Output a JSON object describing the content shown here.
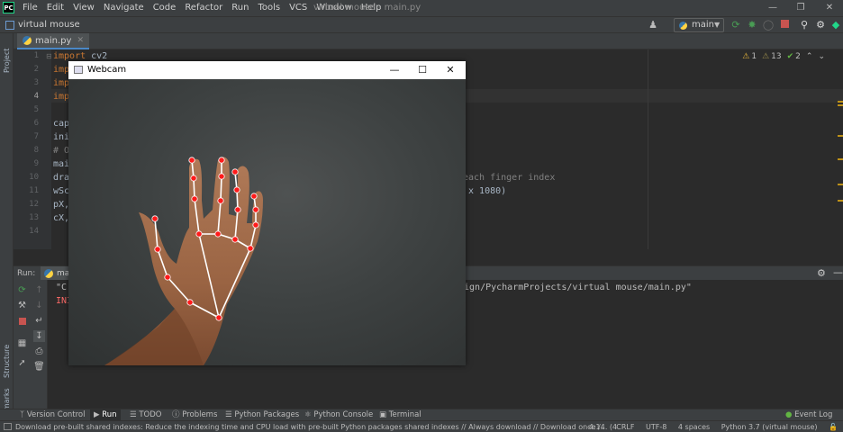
{
  "ide": {
    "logo": "PC",
    "menus": [
      "File",
      "Edit",
      "View",
      "Navigate",
      "Code",
      "Refactor",
      "Run",
      "Tools",
      "VCS",
      "Window",
      "Help"
    ],
    "window_title": "virtual mouse - main.py",
    "window_controls": [
      "minimize-icon",
      "restore-icon",
      "close-icon"
    ]
  },
  "navbar": {
    "project_name": "virtual mouse",
    "run_config": "main",
    "icons": [
      "user-icon",
      "run-icon",
      "debug-icon",
      "coverage-icon",
      "stop-icon",
      "search-icon",
      "gear-icon",
      "toolbox-icon"
    ]
  },
  "editor": {
    "tab_label": "main.py",
    "inspections": {
      "warnings": "1",
      "weak_warnings": "13",
      "typos": "2"
    },
    "line_numbers": [
      "1",
      "2",
      "3",
      "4",
      "5",
      "6",
      "7",
      "8",
      "9",
      "10",
      "11",
      "12",
      "13",
      "14"
    ],
    "lines": [
      {
        "kw": "import",
        "rest": " cv2"
      },
      {
        "kw": "imp",
        "rest": ""
      },
      {
        "kw": "imp",
        "rest": ""
      },
      {
        "kw": "imp",
        "rest": ""
      },
      {
        "kw": "",
        "rest": ""
      },
      {
        "kw": "",
        "rest": "cap"
      },
      {
        "kw": "",
        "rest": "ini"
      },
      {
        "kw": "",
        "rest": "# O"
      },
      {
        "kw": "",
        "rest": "mai"
      },
      {
        "kw": "",
        "rest": "dra"
      },
      {
        "kw": "",
        "rest": "wSc"
      },
      {
        "kw": "",
        "rest": "pX,"
      },
      {
        "kw": "",
        "rest": "cX,"
      },
      {
        "kw": "",
        "rest": ""
      }
    ],
    "right_fragments": {
      "line9": ")",
      "line10": "each finger index",
      "line11": " x 1080)"
    }
  },
  "run_panel": {
    "label": "Run:",
    "tab": "mai",
    "console": {
      "line1_left": "\"C",
      "line1_right": "vign/PycharmProjects/virtual mouse/main.py\"",
      "line2_left": "INI"
    }
  },
  "left_strip": {
    "project": "Project",
    "structure": "Structure",
    "bookmarks": "Bookmarks"
  },
  "tool_windows": [
    {
      "label": "Version Control",
      "icon": "branch-icon"
    },
    {
      "label": "Run",
      "icon": "run-icon",
      "active": true
    },
    {
      "label": "TODO",
      "icon": "list-icon"
    },
    {
      "label": "Problems",
      "icon": "problems-icon"
    },
    {
      "label": "Python Packages",
      "icon": "packages-icon"
    },
    {
      "label": "Python Console",
      "icon": "console-icon"
    },
    {
      "label": "Terminal",
      "icon": "terminal-icon"
    }
  ],
  "event_log": "Event Log",
  "status": {
    "message": "Download pre-built shared indexes: Reduce the indexing time and CPU load with pre-built Python packages shared indexes // Always download // Download once /... (4 minutes ago)",
    "position": "4:14",
    "line_sep": "CRLF",
    "encoding": "UTF-8",
    "indent": "4 spaces",
    "interpreter": "Python 3.7 (virtual mouse)"
  },
  "webcam": {
    "title": "Webcam",
    "controls": [
      "minimize-icon",
      "maximize-icon",
      "close-icon"
    ]
  },
  "colors": {
    "accent": "#4a88c7",
    "landmark": "#ff1a1a",
    "connection": "#ffffff",
    "keyword": "#cc7832"
  }
}
